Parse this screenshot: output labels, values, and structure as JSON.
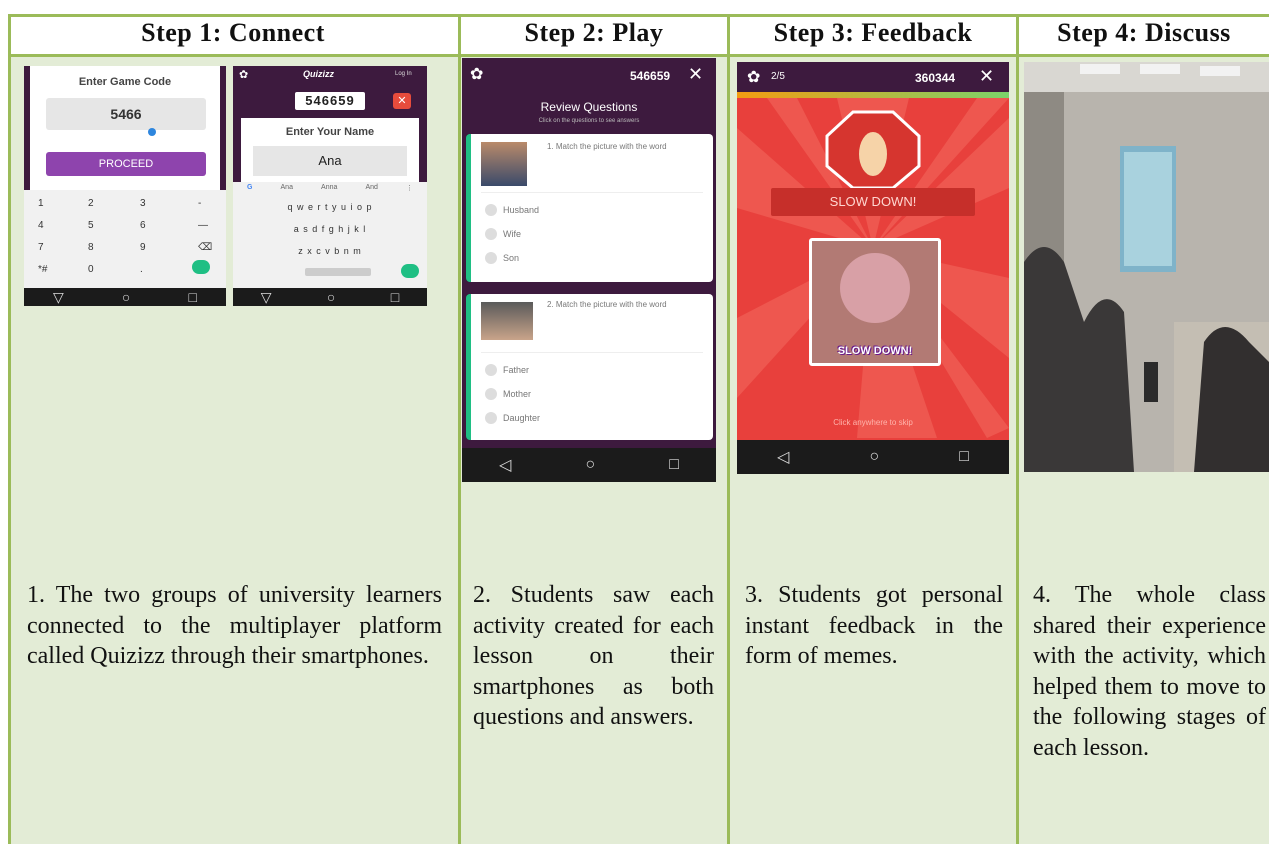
{
  "steps": [
    {
      "title": "Step 1: Connect",
      "description": "1. The two groups of university learners connected to the multiplayer platform called Quizizz through their smartphones."
    },
    {
      "title": "Step 2: Play",
      "description": "2. Students saw each activity created for each lesson on their smartphones as both questions and answers."
    },
    {
      "title": "Step 3: Feedback",
      "description": "3. Students got personal instant feedback in the form of memes."
    },
    {
      "title": "Step 4: Discuss",
      "description": "4. The whole class shared their experience with the activity, which helped them to move to the following stages of each lesson."
    }
  ],
  "phone1": {
    "label": "Enter Game Code",
    "code": "5466",
    "button": "PROCEED",
    "keys": [
      "1",
      "2",
      "3",
      "-",
      "4",
      "5",
      "6",
      "—",
      "7",
      "8",
      "9",
      "⌫",
      "*#",
      "0",
      "."
    ]
  },
  "phone2": {
    "brand": "Quizizz",
    "login": "Log In",
    "code": "546659",
    "label": "Enter Your Name",
    "name": "Ana",
    "suggestions": [
      "Ana",
      "Anna",
      "And"
    ],
    "row1": "q w e r t y u i o p",
    "row2": "a s d f g h j k l",
    "row3": "z x c v b n m"
  },
  "phone3": {
    "code": "546659",
    "title": "Review Questions",
    "subtitle": "Click on the questions to see answers",
    "q1": {
      "text": "1. Match the picture with the word",
      "options": [
        "Husband",
        "Wife",
        "Son"
      ]
    },
    "q2": {
      "text": "2. Match the picture with the word",
      "options": [
        "Father",
        "Mother",
        "Daughter"
      ]
    }
  },
  "phone4": {
    "progress": "2/5",
    "code": "360344",
    "banner": "SLOW DOWN!",
    "meme": "SLOW DOWN!",
    "hint": "Click anywhere to skip"
  },
  "colors": {
    "accent": "#9bbb59",
    "panel": "#e3ecd6",
    "quiz_purple": "#3d1a3e",
    "proceed": "#8e44ad",
    "meme_red": "#e8403c"
  }
}
